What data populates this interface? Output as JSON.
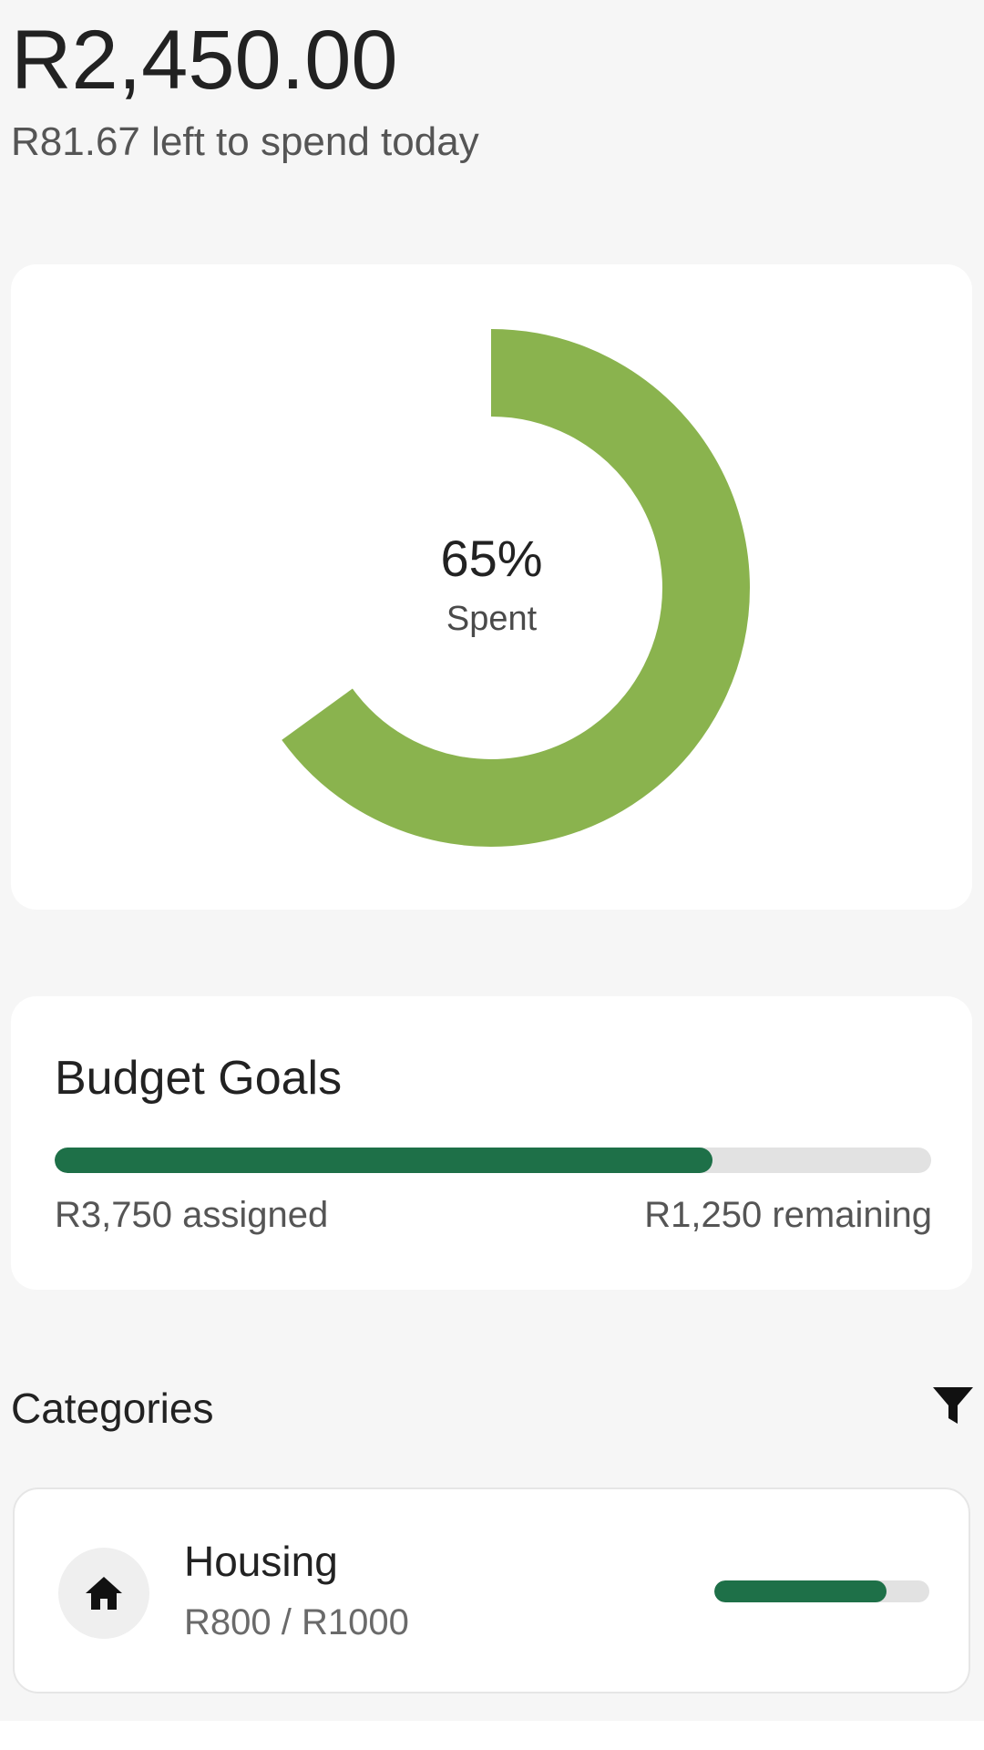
{
  "header": {
    "balance": "R2,450.00",
    "daily_left": "R81.67 left to spend today"
  },
  "spending": {
    "percent_text": "65%",
    "label": "Spent",
    "fraction": 0.65,
    "color": "#8ab34e"
  },
  "budget_goals": {
    "title": "Budget Goals",
    "assigned": "R3,750 assigned",
    "remaining": "R1,250 remaining",
    "progress": 0.75,
    "color": "#1e7048"
  },
  "categories": {
    "title": "Categories",
    "filter_icon": "filter-icon",
    "items": [
      {
        "name": "Housing",
        "amount": "R800 / R1000",
        "icon": "home-icon",
        "progress": 0.8
      }
    ]
  }
}
